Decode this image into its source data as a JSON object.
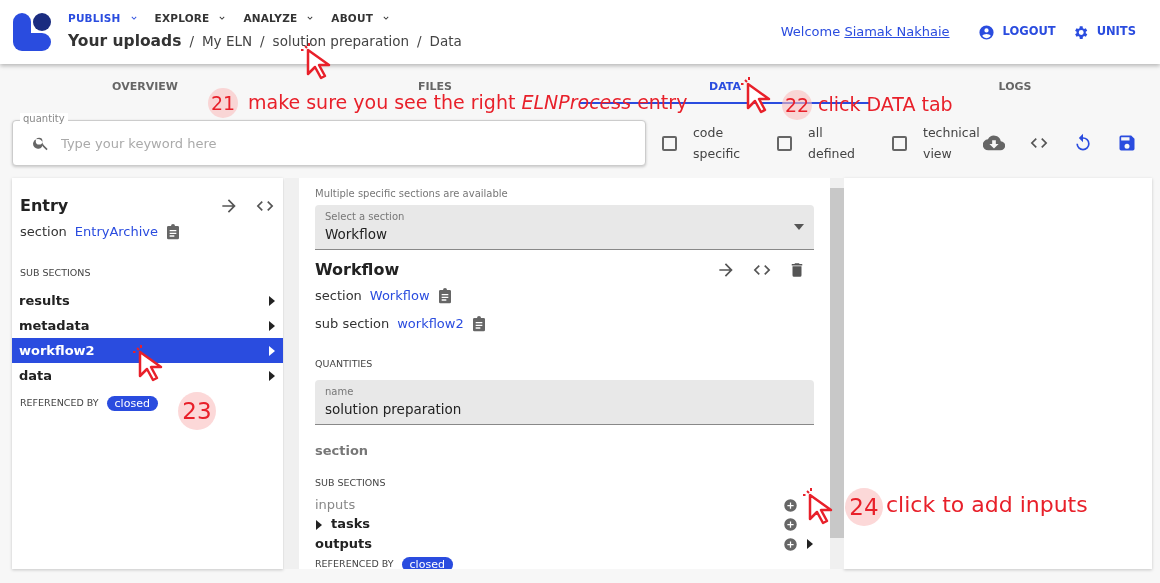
{
  "header": {
    "nav": [
      {
        "label": "PUBLISH",
        "selected": true
      },
      {
        "label": "EXPLORE",
        "selected": false
      },
      {
        "label": "ANALYZE",
        "selected": false
      },
      {
        "label": "ABOUT",
        "selected": false
      }
    ],
    "breadcrumbs": [
      "Your uploads",
      "My ELN",
      "solution preparation",
      "Data"
    ],
    "breadcrumb_separators": [
      "/",
      "/",
      "/"
    ],
    "welcome": "Welcome",
    "user": "Siamak Nakhaie",
    "actions": [
      {
        "label": "LOGOUT",
        "kind": "account"
      },
      {
        "label": "UNITS",
        "kind": "settings"
      }
    ]
  },
  "tabs": [
    {
      "label": "OVERVIEW",
      "selected": false
    },
    {
      "label": "FILES",
      "selected": false
    },
    {
      "label": "DATA",
      "selected": true
    },
    {
      "label": "LOGS",
      "selected": false
    }
  ],
  "search": {
    "label": "quantity",
    "placeholder": "Type your keyword here"
  },
  "filters": [
    {
      "label": "code specific",
      "checked": false
    },
    {
      "label": "all defined",
      "checked": false
    },
    {
      "label": "technical view",
      "checked": false
    }
  ],
  "left_panel": {
    "title": "Entry",
    "section_label": "section",
    "section_link": "EntryArchive",
    "subsections_heading": "SUB SECTIONS",
    "items": [
      {
        "label": "results",
        "selected": false
      },
      {
        "label": "metadata",
        "selected": false
      },
      {
        "label": "workflow2",
        "selected": true
      },
      {
        "label": "data",
        "selected": false
      }
    ],
    "referenced_by": "REFERENCED BY",
    "badge": "closed"
  },
  "middle_panel": {
    "hint": "Multiple specific sections are available",
    "select": {
      "label": "Select a section",
      "value": "Workflow"
    },
    "title": "Workflow",
    "section_label": "section",
    "section_link": "Workflow",
    "subsection_label": "sub section",
    "subsection_link": "workflow2",
    "quantities_heading": "QUANTITIES",
    "name_field": {
      "label": "name",
      "value": "solution preparation"
    },
    "section_item": "section",
    "subsections_heading": "SUB SECTIONS",
    "items": [
      {
        "label": "inputs",
        "kind": "empty"
      },
      {
        "label": "tasks",
        "kind": "collapsible"
      },
      {
        "label": "outputs",
        "kind": "expandable"
      }
    ],
    "referenced_by": "REFERENCED BY",
    "badge": "closed"
  },
  "annotations": [
    {
      "number": "21",
      "text": "make sure you see the right *ELNProcess* entry"
    },
    {
      "number": "22",
      "text": "click DATA tab"
    },
    {
      "number": "23"
    },
    {
      "number": "24",
      "text": "click to add inputs"
    }
  ]
}
